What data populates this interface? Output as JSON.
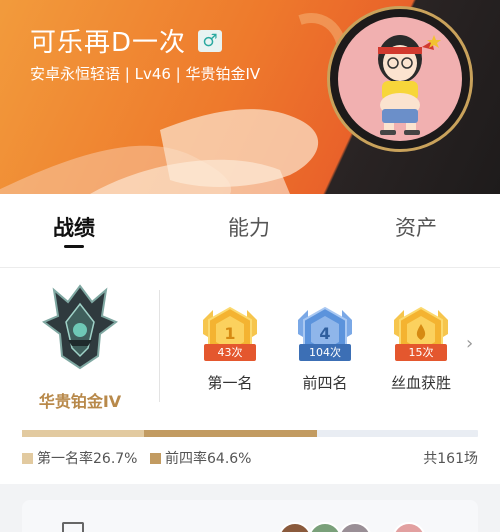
{
  "profile": {
    "nickname": "可乐再D一次",
    "gender_symbol": "♂",
    "subinfo": "安卓永恒轻语 | Lv46 | 华贵铂金IV"
  },
  "tabs": [
    {
      "label": "战绩",
      "active": true
    },
    {
      "label": "能力",
      "active": false
    },
    {
      "label": "资产",
      "active": false
    }
  ],
  "rank": {
    "tier_name": "华贵铂金IV",
    "badges": [
      {
        "icon": "first-place-badge",
        "number": "1",
        "count": "43次",
        "label": "第一名",
        "color": "#f2b739"
      },
      {
        "icon": "top-four-badge",
        "number": "4",
        "count": "104次",
        "label": "前四名",
        "color": "#4f8ad6"
      },
      {
        "icon": "blood-win-badge",
        "number": "",
        "count": "15次",
        "label": "丝血获胜",
        "color": "#f2b739"
      }
    ],
    "first_rate": 0.267,
    "top4_rate": 0.646,
    "first_rate_text": "第一名率26.7%",
    "top4_rate_text": "前四率64.6%",
    "total_text": "共161场"
  },
  "colors": {
    "first_bar": "#e2caa0",
    "top4_bar": "#c29b61",
    "tier_text": "#b8894a"
  }
}
